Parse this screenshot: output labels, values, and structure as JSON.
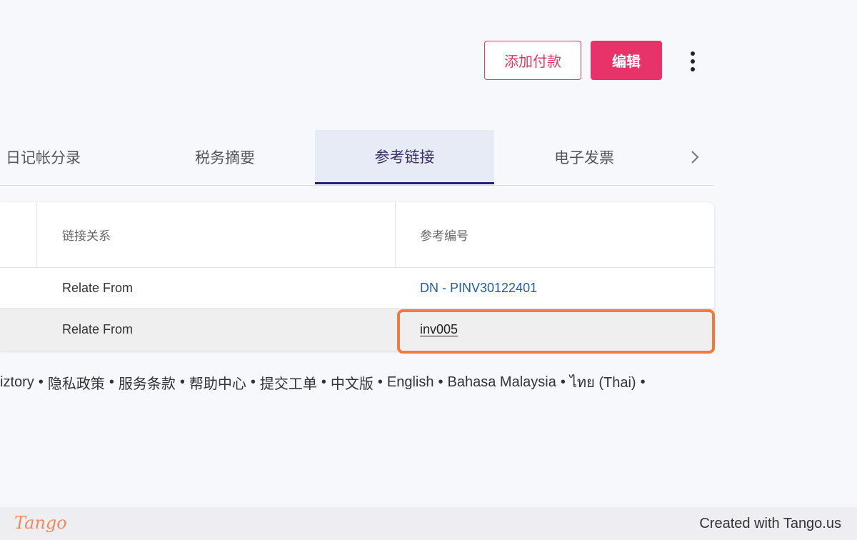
{
  "header": {
    "add_payment_label": "添加付款",
    "edit_label": "编辑"
  },
  "tabs": [
    {
      "label": "日记帐分录",
      "active": false
    },
    {
      "label": "税务摘要",
      "active": false
    },
    {
      "label": "参考链接",
      "active": true
    },
    {
      "label": "电子发票",
      "active": false
    }
  ],
  "table": {
    "columns": [
      "链接关系",
      "参考编号"
    ],
    "rows": [
      {
        "relation": "Relate From",
        "reference": "DN - PINV30122401"
      },
      {
        "relation": "Relate From",
        "reference": "inv005"
      }
    ]
  },
  "footer_links": [
    "iztory",
    "隐私政策",
    "服务条款",
    "帮助中心",
    "提交工单",
    "中文版",
    "English",
    "Bahasa Malaysia",
    "ไทย (Thai)",
    ""
  ],
  "tango": {
    "logo": "Tango",
    "credit": "Created with Tango.us"
  },
  "colors": {
    "accent": "#e8336a",
    "highlight": "#f47a3c",
    "link": "#1f5fa8",
    "active_tab_bg": "#e6ebf5"
  },
  "icons": {
    "more": "more-vertical-icon",
    "next": "chevron-right-icon"
  }
}
